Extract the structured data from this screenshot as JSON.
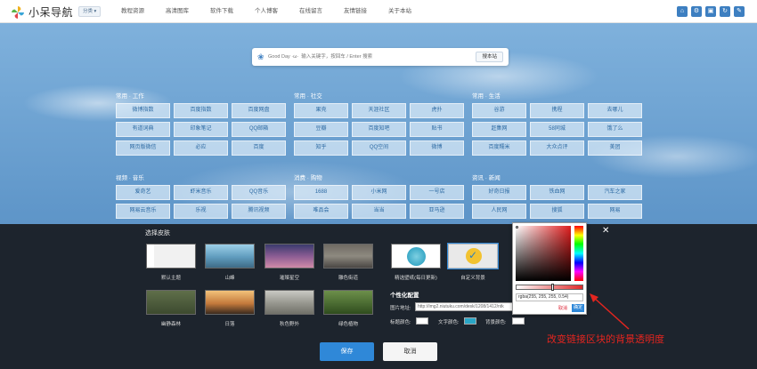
{
  "header": {
    "logo_text": "小呆导航",
    "category_button": "分类 ▾",
    "nav": [
      "教程资源",
      "高清图库",
      "软件下载",
      "个人博客",
      "在线留言",
      "友情链接",
      "关于本站"
    ],
    "tool_icons": [
      "home-icon",
      "gear-icon",
      "image-icon",
      "refresh-icon",
      "edit-icon"
    ]
  },
  "search": {
    "placeholder": "Good Day ·ω·  输入关键字，按回车 / Enter 搜索",
    "button": "搜本站"
  },
  "groups": [
    {
      "title": "常用 · 工作",
      "links": [
        "微博指数",
        "百度指数",
        "百度网盘",
        "有道词典",
        "印象笔记",
        "QQ邮箱",
        "网页版微信",
        "必应",
        "百度"
      ]
    },
    {
      "title": "常用 · 社交",
      "links": [
        "果壳",
        "天涯社区",
        "虎扑",
        "豆瓣",
        "百度知吧",
        "贴书",
        "知乎",
        "QQ空间",
        "微博"
      ]
    },
    {
      "title": "常用 · 生活",
      "links": [
        "谷游",
        "携程",
        "去哪儿",
        "赶集网",
        "58同城",
        "饿了么",
        "百度糯米",
        "大众点评",
        "美团"
      ]
    },
    {
      "title": "视频 · 音乐",
      "links": [
        "爱奇艺",
        "虾米音乐",
        "QQ音乐",
        "网易云音乐",
        "乐视",
        "腾讯视频"
      ]
    },
    {
      "title": "消费 · 购物",
      "links": [
        "1688",
        "小米网",
        "一号店",
        "唯品会",
        "当当",
        "亚马逊"
      ]
    },
    {
      "title": "资讯 · 新闻",
      "links": [
        "好奇日报",
        "铁血网",
        "汽车之家",
        "人民网",
        "搜狐",
        "网易"
      ]
    }
  ],
  "skin_panel": {
    "title": "选择皮肤",
    "themes": [
      {
        "label": "默认主题",
        "style": "t-default"
      },
      {
        "label": "山峰",
        "style": "t-mountain"
      },
      {
        "label": "璀璨星空",
        "style": "t-sky"
      },
      {
        "label": "雕色街道",
        "style": "t-street"
      },
      {
        "label": "精选壁纸(每日更新)",
        "style": "t-daily"
      },
      {
        "label": "自定义背景",
        "style": "t-custom"
      },
      {
        "label": "幽静森林",
        "style": "t-forest"
      },
      {
        "label": "日落",
        "style": "t-sunset"
      },
      {
        "label": "秋色野外",
        "style": "t-autumn"
      },
      {
        "label": "绿色植物",
        "style": "t-green"
      }
    ],
    "personalize_title": "个性化配置",
    "image_url_label": "图片地址:",
    "image_url_value": "http://img2.niutuku.com/desk/1208/1412/ntk",
    "title_color_label": "标题颜色:",
    "text_color_label": "文字颜色:",
    "bg_color_label": "背景颜色:",
    "title_color": "#ffffff",
    "text_color": "#2aa6c6",
    "bg_color": "#ffffff"
  },
  "color_picker": {
    "value": "rgba(255, 255, 255, 0.54)",
    "cancel": "取消",
    "ok": "确定"
  },
  "actions": {
    "save": "保存",
    "cancel": "取消"
  },
  "annotation": "改变链接区块的背景透明度",
  "colors": {
    "accent": "#2f88d8",
    "annotation": "#e4251f"
  }
}
